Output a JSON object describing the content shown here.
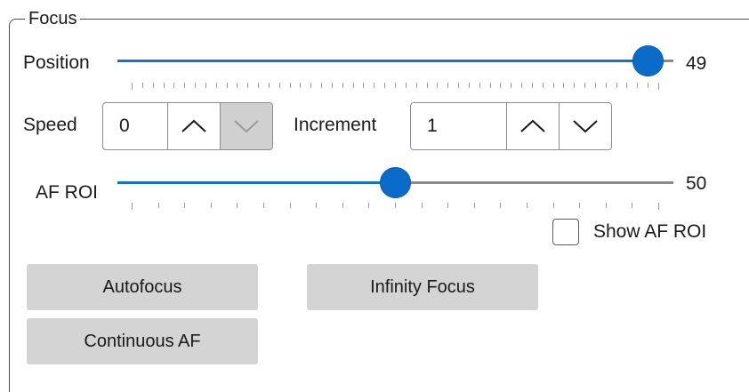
{
  "group": {
    "title": "Focus"
  },
  "position": {
    "label": "Position",
    "value": 49,
    "min": 0,
    "max": 50
  },
  "speed": {
    "label": "Speed",
    "value": "0",
    "up_enabled": true,
    "down_enabled": false
  },
  "increment": {
    "label": "Increment",
    "value": "1",
    "up_enabled": true,
    "down_enabled": true
  },
  "af_roi": {
    "label": "AF ROI",
    "value": 50,
    "min": 0,
    "max": 100
  },
  "show_af_roi": {
    "label": "Show AF ROI",
    "checked": false
  },
  "buttons": {
    "autofocus": "Autofocus",
    "infinity_focus": "Infinity Focus",
    "continuous_af": "Continuous AF"
  },
  "colors": {
    "accent": "#0a6cc8",
    "rail": "#8a8a8a",
    "button_bg": "#d4d4d4",
    "disabled_bg": "#d0d0d0"
  }
}
